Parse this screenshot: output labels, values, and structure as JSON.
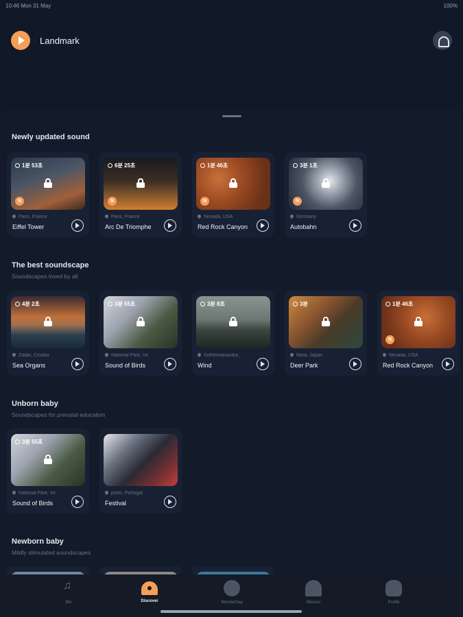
{
  "status_bar": {
    "left": "10:46 Mon 31 May",
    "right": "100%"
  },
  "header": {
    "title": "Landmark"
  },
  "sections": [
    {
      "title": "Newly updated sound",
      "subtitle": "",
      "cards": [
        {
          "duration": "1분 53초",
          "location": "Paris, France",
          "title": "Eiffel Tower",
          "new": "N"
        },
        {
          "duration": "6분 25초",
          "location": "Paris, France",
          "title": "Arc De Triomphe",
          "new": "N"
        },
        {
          "duration": "1분 46초",
          "location": "Nevada, USA",
          "title": "Red Rock Canyon",
          "new": "N"
        },
        {
          "duration": "3분 1초",
          "location": "Germany",
          "title": "Autobahn",
          "new": "N"
        }
      ]
    },
    {
      "title": "The best soundscape",
      "subtitle": "Soundscapes loved by all.",
      "cards": [
        {
          "duration": "4분 2초",
          "location": "Zadar, Croatia",
          "title": "Sea Organs"
        },
        {
          "duration": "3분 55초",
          "location": "National Park, Vir",
          "title": "Sound of Birds"
        },
        {
          "duration": "3분 8초",
          "location": "Solheimasandur,",
          "title": "Wind"
        },
        {
          "duration": "3분",
          "location": "Nara, Japan",
          "title": "Deer Park"
        },
        {
          "duration": "1분 46초",
          "location": "Nevada, USA",
          "title": "Red Rock Canyon",
          "new": "N"
        }
      ]
    },
    {
      "title": "Unborn baby",
      "subtitle": "Soundscapes for prenatal education",
      "cards": [
        {
          "duration": "3분 55초",
          "location": "National Park, Vir",
          "title": "Sound of Birds"
        },
        {
          "duration": "",
          "location": "porto, Portugal",
          "title": "Festival"
        }
      ]
    },
    {
      "title": "Newborn baby",
      "subtitle": "Mildly stimulated soundscapes",
      "cards": []
    }
  ],
  "tabs": [
    {
      "label": "Mix",
      "icon": "music-notes-icon",
      "active": false
    },
    {
      "label": "Discover",
      "icon": "discover-icon",
      "active": true
    },
    {
      "label": "WonderDay",
      "icon": "wonderday-icon",
      "active": false
    },
    {
      "label": "Mission",
      "icon": "mission-icon",
      "active": false
    },
    {
      "label": "Profile",
      "icon": "profile-icon",
      "active": false
    }
  ],
  "colors": {
    "accent": "#f59e58",
    "background": "#111827",
    "card": "#182133"
  }
}
